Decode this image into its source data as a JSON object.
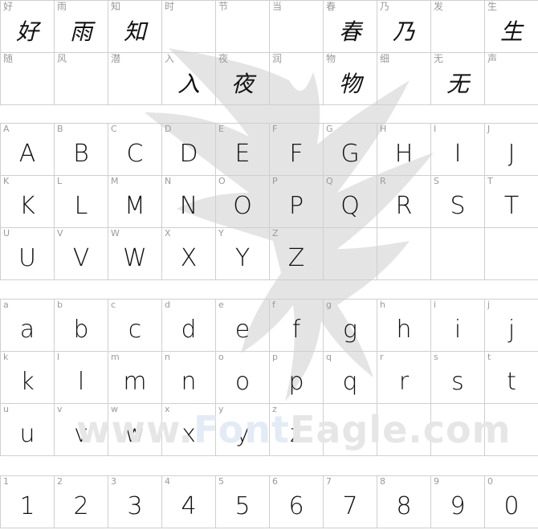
{
  "chinese": {
    "row1": [
      {
        "label": "好",
        "glyph": "好"
      },
      {
        "label": "雨",
        "glyph": "雨"
      },
      {
        "label": "知",
        "glyph": "知"
      },
      {
        "label": "时",
        "glyph": ""
      },
      {
        "label": "节",
        "glyph": ""
      },
      {
        "label": "当",
        "glyph": ""
      },
      {
        "label": "春",
        "glyph": "春"
      },
      {
        "label": "乃",
        "glyph": "乃"
      },
      {
        "label": "发",
        "glyph": ""
      },
      {
        "label": "生",
        "glyph": "生"
      }
    ],
    "row2": [
      {
        "label": "随",
        "glyph": ""
      },
      {
        "label": "风",
        "glyph": ""
      },
      {
        "label": "潜",
        "glyph": ""
      },
      {
        "label": "入",
        "glyph": "入"
      },
      {
        "label": "夜",
        "glyph": "夜"
      },
      {
        "label": "润",
        "glyph": ""
      },
      {
        "label": "物",
        "glyph": "物"
      },
      {
        "label": "细",
        "glyph": ""
      },
      {
        "label": "无",
        "glyph": "无"
      },
      {
        "label": "声",
        "glyph": ""
      }
    ]
  },
  "uppercase": {
    "row1": [
      "A",
      "B",
      "C",
      "D",
      "E",
      "F",
      "G",
      "H",
      "I",
      "J"
    ],
    "row2": [
      "K",
      "L",
      "M",
      "N",
      "O",
      "P",
      "Q",
      "R",
      "S",
      "T"
    ],
    "row3": [
      "U",
      "V",
      "W",
      "X",
      "Y",
      "Z",
      "",
      "",
      "",
      ""
    ]
  },
  "lowercase": {
    "row1": [
      "a",
      "b",
      "c",
      "d",
      "e",
      "f",
      "g",
      "h",
      "i",
      "j"
    ],
    "row2": [
      "k",
      "l",
      "m",
      "n",
      "o",
      "p",
      "q",
      "r",
      "s",
      "t"
    ],
    "row3": [
      "u",
      "v",
      "w",
      "x",
      "y",
      "z",
      "",
      "",
      "",
      ""
    ]
  },
  "digits": {
    "row1": [
      "1",
      "2",
      "3",
      "4",
      "5",
      "6",
      "7",
      "8",
      "9",
      "0"
    ]
  },
  "watermark": {
    "prefix": "www.",
    "brand_blue": "Font",
    "brand_rest": "Eagle",
    "suffix": ".com",
    "icon": "eagle-icon"
  }
}
